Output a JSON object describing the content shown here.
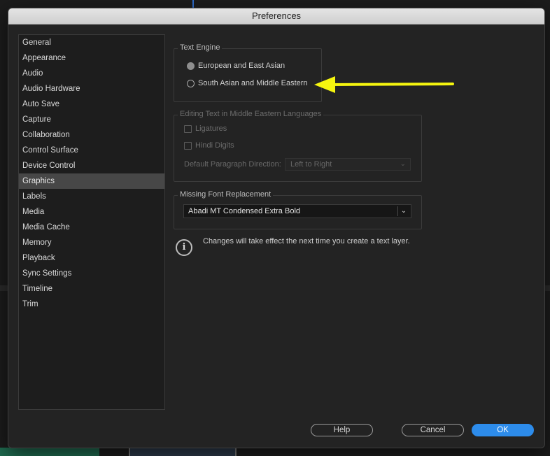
{
  "window": {
    "title": "Preferences"
  },
  "sidebar": {
    "items": [
      {
        "label": "General"
      },
      {
        "label": "Appearance"
      },
      {
        "label": "Audio"
      },
      {
        "label": "Audio Hardware"
      },
      {
        "label": "Auto Save"
      },
      {
        "label": "Capture"
      },
      {
        "label": "Collaboration"
      },
      {
        "label": "Control Surface"
      },
      {
        "label": "Device Control"
      },
      {
        "label": "Graphics",
        "selected": true
      },
      {
        "label": "Labels"
      },
      {
        "label": "Media"
      },
      {
        "label": "Media Cache"
      },
      {
        "label": "Memory"
      },
      {
        "label": "Playback"
      },
      {
        "label": "Sync Settings"
      },
      {
        "label": "Timeline"
      },
      {
        "label": "Trim"
      }
    ]
  },
  "text_engine": {
    "title": "Text Engine",
    "option_european": "European and East Asian",
    "option_south_asian": "South Asian and Middle Eastern",
    "selected": "European and East Asian"
  },
  "middle_eastern": {
    "title": "Editing Text in Middle Eastern Languages",
    "ligatures_label": "Ligatures",
    "hindi_digits_label": "Hindi Digits",
    "direction_label": "Default Paragraph Direction:",
    "direction_value": "Left to Right"
  },
  "missing_font": {
    "title": "Missing Font Replacement",
    "value": "Abadi MT Condensed Extra Bold"
  },
  "info": {
    "message": "Changes will take effect the next time you create a text layer."
  },
  "footer": {
    "help_label": "Help",
    "cancel_label": "Cancel",
    "ok_label": "OK"
  },
  "colors": {
    "accent": "#2d8ceb",
    "annotation_arrow": "#f5f50f"
  }
}
